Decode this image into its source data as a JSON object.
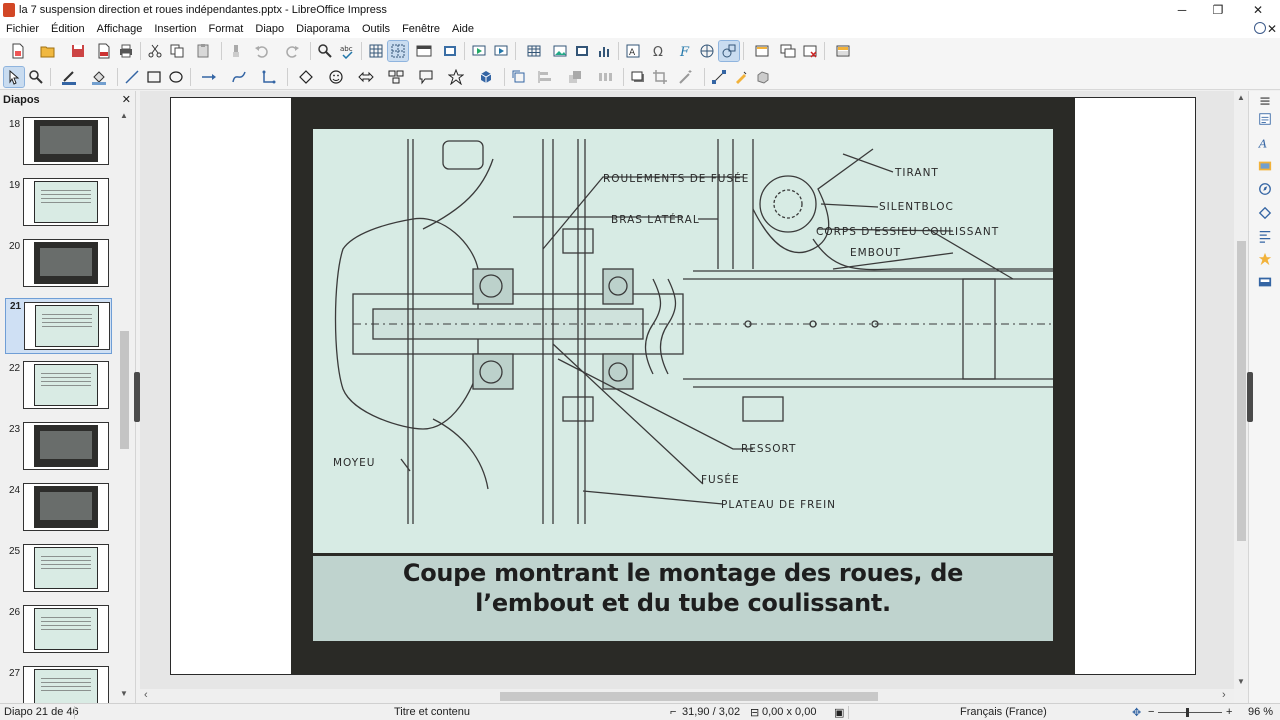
{
  "window": {
    "title": "la 7 suspension direction et roues indépendantes.pptx - LibreOffice Impress",
    "controls": {
      "minimize": "─",
      "maximize": "❐",
      "close": "✕"
    }
  },
  "menu": [
    "Fichier",
    "Édition",
    "Affichage",
    "Insertion",
    "Format",
    "Diapo",
    "Diaporama",
    "Outils",
    "Fenêtre",
    "Aide"
  ],
  "menu_close": "✕",
  "slide_panel": {
    "title": "Diapos",
    "close": "✕",
    "slides": [
      {
        "num": "18",
        "style": "dark"
      },
      {
        "num": "19",
        "style": "light"
      },
      {
        "num": "20",
        "style": "dark"
      },
      {
        "num": "21",
        "style": "light",
        "selected": true
      },
      {
        "num": "22",
        "style": "light"
      },
      {
        "num": "23",
        "style": "dark"
      },
      {
        "num": "24",
        "style": "dark"
      },
      {
        "num": "25",
        "style": "light"
      },
      {
        "num": "26",
        "style": "light"
      },
      {
        "num": "27",
        "style": "light"
      }
    ]
  },
  "slide": {
    "caption_line1": "Coupe montrant le montage des roues, de",
    "caption_line2": "l’embout et du tube coulissant.",
    "labels": {
      "roulements": "ROULEMENTS DE FUSÉE",
      "tirant": "TIRANT",
      "bras": "BRAS LATÉRAL",
      "silentbloc": "SILENTBLOC",
      "corps": "CORPS D'ESSIEU COULISSANT",
      "embout": "EMBOUT",
      "moyeu": "MOYEU",
      "ressort": "RESSORT",
      "fusee": "FUSÉE",
      "plateau": "PLATEAU DE FREIN"
    }
  },
  "status": {
    "slide_pos": "Diapo 21 de 46",
    "layout": "Titre et contenu",
    "position": "31,90 / 3,02",
    "size": "0,00 x 0,00",
    "language": "Français (France)",
    "zoom": "96 %",
    "zoom_minus": "−",
    "zoom_plus": "+"
  },
  "colors": {
    "accent": "#c9dcf0",
    "drawing_bg": "#d7ebe4",
    "photo_frame": "#2a2a26"
  }
}
